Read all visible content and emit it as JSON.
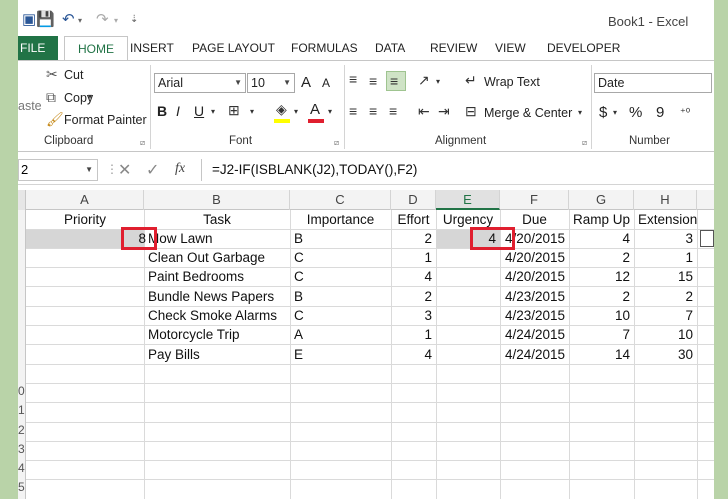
{
  "window": {
    "title": "Book1 - Excel"
  },
  "tabs": [
    "FILE",
    "HOME",
    "INSERT",
    "PAGE LAYOUT",
    "FORMULAS",
    "DATA",
    "REVIEW",
    "VIEW",
    "DEVELOPER"
  ],
  "ribbon": {
    "clipboard": {
      "paste": "aste",
      "cut": "Cut",
      "copy": "Copy",
      "format_painter": "Format Painter",
      "label": "Clipboard"
    },
    "font": {
      "name": "Arial",
      "size": "10",
      "grow": "A",
      "shrink": "A",
      "bold": "B",
      "italic": "I",
      "underline": "U",
      "label": "Font"
    },
    "alignment": {
      "wrap_text": "Wrap Text",
      "merge_center": "Merge & Center",
      "label": "Alignment"
    },
    "number": {
      "format": "Date",
      "currency": "$",
      "percent": "%",
      "comma": "9",
      "label": "Number"
    }
  },
  "formula_bar": {
    "name_box": "2",
    "fx": "fx",
    "formula": "=J2-IF(ISBLANK(J2),TODAY(),F2)"
  },
  "columns": [
    "A",
    "B",
    "C",
    "D",
    "E",
    "F",
    "G",
    "H"
  ],
  "selected_column": "E",
  "headers": [
    "Priority",
    "Task",
    "Importance",
    "Effort",
    "Urgency",
    "Due",
    "Ramp Up",
    "Extension"
  ],
  "rows": [
    {
      "priority": "8",
      "task": "Mow Lawn",
      "importance": "B",
      "effort": "2",
      "urgency": "4",
      "due": "4/20/2015",
      "ramp_up": "4",
      "extension": "3"
    },
    {
      "priority": "",
      "task": "Clean Out Garbage",
      "importance": "C",
      "effort": "1",
      "urgency": "",
      "due": "4/20/2015",
      "ramp_up": "2",
      "extension": "1"
    },
    {
      "priority": "",
      "task": "Paint Bedrooms",
      "importance": "C",
      "effort": "4",
      "urgency": "",
      "due": "4/20/2015",
      "ramp_up": "12",
      "extension": "15"
    },
    {
      "priority": "",
      "task": "Bundle News Papers",
      "importance": "B",
      "effort": "2",
      "urgency": "",
      "due": "4/23/2015",
      "ramp_up": "2",
      "extension": "2"
    },
    {
      "priority": "",
      "task": "Check Smoke Alarms",
      "importance": "C",
      "effort": "3",
      "urgency": "",
      "due": "4/23/2015",
      "ramp_up": "10",
      "extension": "7"
    },
    {
      "priority": "",
      "task": "Motorcycle Trip",
      "importance": "A",
      "effort": "1",
      "urgency": "",
      "due": "4/24/2015",
      "ramp_up": "7",
      "extension": "10"
    },
    {
      "priority": "",
      "task": "Pay Bills",
      "importance": "E",
      "effort": "4",
      "urgency": "",
      "due": "4/24/2015",
      "ramp_up": "14",
      "extension": "30"
    }
  ],
  "row_numbers": [
    "",
    "",
    "",
    "",
    "",
    "",
    "",
    "",
    "",
    "",
    "0",
    "1",
    "2",
    "3",
    "4",
    "5"
  ],
  "colors": {
    "accent": "#217346",
    "highlight": "#e01f2f",
    "background": "#b9d3a8"
  }
}
